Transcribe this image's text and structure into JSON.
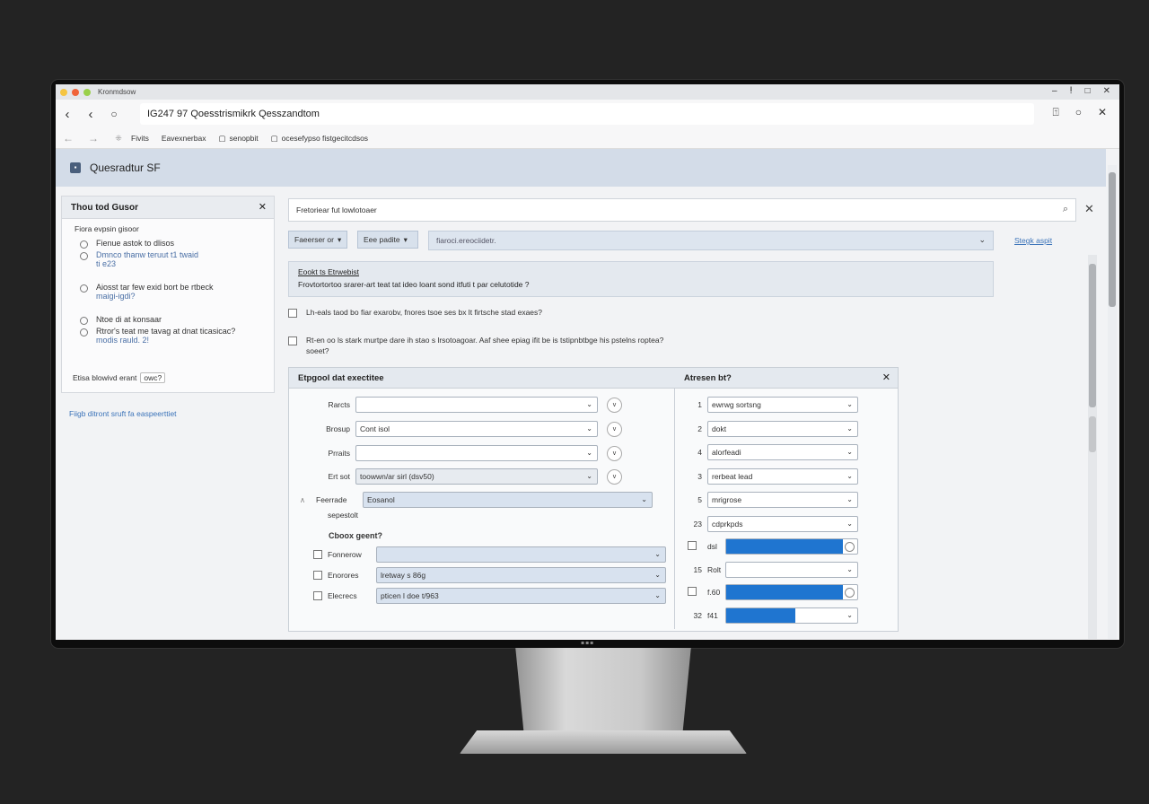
{
  "window": {
    "title": "Kronmdsow"
  },
  "urlbar": {
    "url": "IG247 97  Qoesstrismikrk Qesszandtom"
  },
  "bookmarks": [
    "Fivits",
    "Eavexnerbax",
    "senopbit",
    "ocesefypso fistgecitcdsos"
  ],
  "app": {
    "title": "Quesradtur SF"
  },
  "left_panel": {
    "title": "Thou tod Gusor",
    "subtitle": "Fiora evpsin gisoor",
    "options": [
      {
        "line1": "Fienue astok to dlisos",
        "line2": ""
      },
      {
        "line1": "Dmnco thanw teruut t1 twaid",
        "line2": "ti e23"
      },
      {
        "line1": "Aiosst tar few exid bort be rtbeck",
        "line2": "maigi-igdi?"
      },
      {
        "line1": "Ntoe di at konsaar",
        "line2": ""
      },
      {
        "line1": "Rtror's teat me tavag at dnat ticasicac?",
        "line2": "modis rauld. 2!"
      }
    ],
    "footer_label": "Etisa blowivd erant",
    "footer_chip": "owc?"
  },
  "left_link": "Fiigb ditront sruft fa easpeerttiet",
  "search": {
    "placeholder": "Fretoriear fut lowlotoaer"
  },
  "toolbar": {
    "btn1": "Faeerser or",
    "btn2": "Eee padite",
    "filter": "fiaroci.ereociidetr.",
    "link": "Stegk aspit"
  },
  "notice": {
    "title": "Eookt ts Etrwebist",
    "body": "Frovtortortoo srarer-art teat tat ideo loant sond itfuti t par celutotide ?"
  },
  "checks": [
    {
      "text": "Lh-eals taod bo fiar exarobv, fnores tsoe ses bx lt firtsche stad exaes?"
    },
    {
      "text": "Rt-en oo ls stark murtpe dare ih stao s lrsotoagoar. Aaf shee epiag ifit be is tstipnbtbge his pstelns roptea?",
      "text2": "soeet?"
    }
  ],
  "dialog": {
    "left_title": "Etpgool dat exectitee",
    "right_title": "Atresen bt?",
    "fields": [
      {
        "label": "Rarcts",
        "value": "",
        "style": "white",
        "btn": "v"
      },
      {
        "label": "Brosup",
        "value": "Cont isol",
        "style": "white",
        "btn": "v"
      },
      {
        "label": "Prraits",
        "value": "",
        "style": "white",
        "btn": "v"
      },
      {
        "label": "Ert sot",
        "value": "toowwn/ar sirl (dsv50)",
        "style": "grey",
        "btn": "v"
      }
    ],
    "feature": {
      "label": "Feerrade",
      "value": "Eosanol",
      "sublabel": "sepestolt"
    },
    "section": "Cboox geent?",
    "checked_fields": [
      {
        "label": "Fonnerow",
        "value": ""
      },
      {
        "label": "Enorores",
        "value": "lretway s 86g"
      },
      {
        "label": "Elecrecs",
        "value": "pticen l doe t/963"
      }
    ],
    "right_rows": [
      {
        "num": "1",
        "value": "ewrwg sortsng",
        "kind": "select"
      },
      {
        "num": "2",
        "value": "dokt",
        "kind": "select"
      },
      {
        "num": "4",
        "value": "alorfeadi",
        "kind": "select"
      },
      {
        "num": "3",
        "value": "rerbeat lead",
        "kind": "select"
      },
      {
        "num": "5",
        "value": "mrigrose",
        "kind": "select"
      },
      {
        "num": "23",
        "value": "cdprkpds",
        "kind": "select"
      },
      {
        "num": "",
        "value": "dsl",
        "kind": "bar",
        "fill": 0.89,
        "box": true
      },
      {
        "num": "15",
        "value": "Rolt",
        "kind": "bar",
        "fill": 0.0,
        "box": false
      },
      {
        "num": "",
        "value": "f.60",
        "kind": "bar",
        "fill": 0.89,
        "box": true
      },
      {
        "num": "32",
        "value": "f41",
        "kind": "bar",
        "fill": 0.53,
        "box": false
      }
    ]
  },
  "colors": {
    "accent": "#1f75d0",
    "header_bg": "#d3dce8",
    "link": "#3b73b9"
  }
}
